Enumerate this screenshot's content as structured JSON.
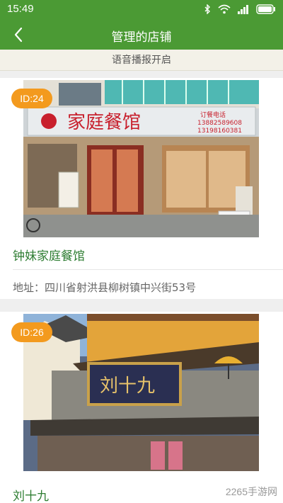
{
  "status_bar": {
    "time": "15:49",
    "icons": [
      "bluetooth-icon",
      "wifi-icon",
      "signal-icon",
      "battery-icon"
    ]
  },
  "header": {
    "title": "管理的店铺"
  },
  "voice_broadcast": {
    "label": "语音播报开启"
  },
  "stores": [
    {
      "id_badge": "ID:24",
      "name": "钟妹家庭餐馆",
      "address": "地址：四川省射洪县柳树镇中兴街53号",
      "sign_text": "家庭餐馆",
      "phone_label": "订餐电话",
      "phone_1": "13882589608",
      "phone_2": "13198160381"
    },
    {
      "id_badge": "ID:26",
      "name": "刘十九",
      "sign_text": "刘十九"
    }
  ],
  "watermark": "2265手游网",
  "colors": {
    "primary_green": "#4b9a34",
    "badge_orange": "#f39a1e",
    "name_green": "#2e7d32"
  }
}
